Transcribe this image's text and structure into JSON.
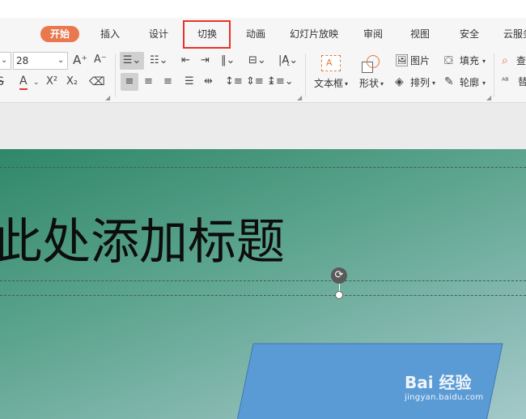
{
  "tabs": [
    {
      "label": "开始"
    },
    {
      "label": "插入"
    },
    {
      "label": "设计"
    },
    {
      "label": "切换"
    },
    {
      "label": "动画"
    },
    {
      "label": "幻灯片放映"
    },
    {
      "label": "审阅"
    },
    {
      "label": "视图"
    },
    {
      "label": "安全"
    },
    {
      "label": "云服务"
    }
  ],
  "ribbon": {
    "font_size": "28",
    "text_box_label": "文本框",
    "shape_label": "形状",
    "picture_label": "图片",
    "arrange_label": "排列",
    "fill_label": "填充",
    "outline_label": "轮廓",
    "find_label": "查"
  },
  "slide": {
    "title": "此处添加标题"
  },
  "watermark": {
    "brand": "Bai 经验",
    "url": "jingyan.baidu.com"
  },
  "colors": {
    "accent_tab": "#e9774f",
    "highlight_box": "#e8322a",
    "shape_fill": "#5b9bd5"
  }
}
